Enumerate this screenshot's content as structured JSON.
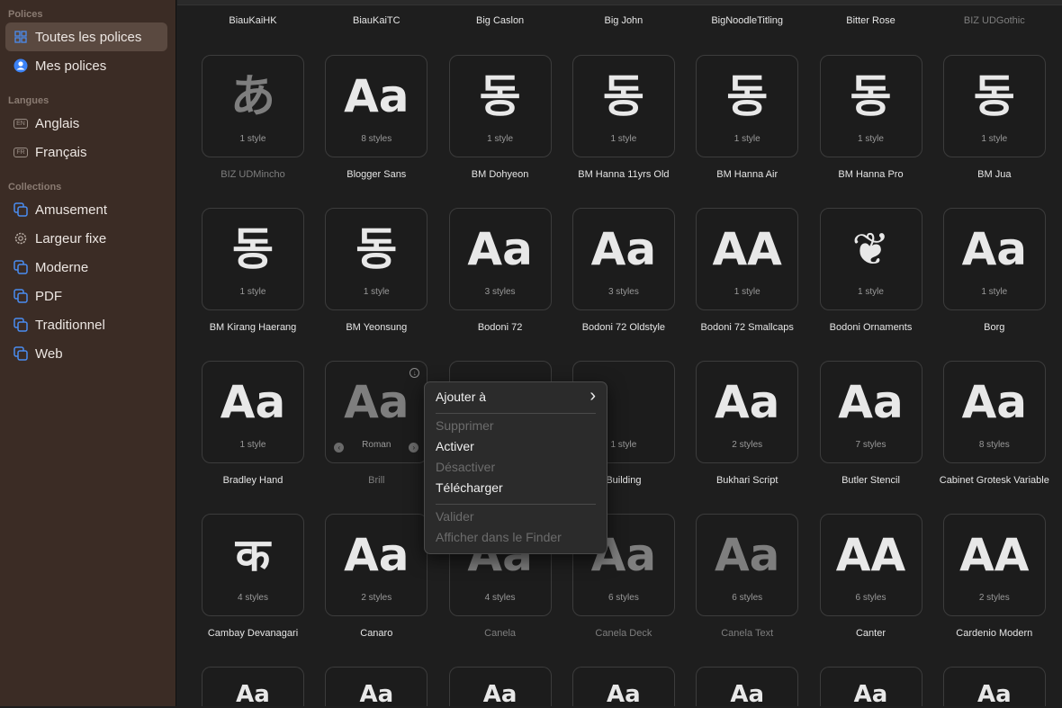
{
  "sidebar": {
    "sections": {
      "fonts": "Polices",
      "languages": "Langues",
      "collections": "Collections"
    },
    "fonts": [
      {
        "label": "Toutes les polices",
        "icon": "grid-icon",
        "selected": true
      },
      {
        "label": "Mes polices",
        "icon": "person-circle-icon"
      }
    ],
    "languages": [
      {
        "label": "Anglais",
        "badge": "EN"
      },
      {
        "label": "Français",
        "badge": "FR"
      }
    ],
    "collections": [
      {
        "label": "Amusement",
        "icon": "collection-icon"
      },
      {
        "label": "Largeur fixe",
        "icon": "gear-icon"
      },
      {
        "label": "Moderne",
        "icon": "collection-icon"
      },
      {
        "label": "PDF",
        "icon": "collection-icon"
      },
      {
        "label": "Traditionnel",
        "icon": "collection-icon"
      },
      {
        "label": "Web",
        "icon": "collection-icon"
      }
    ]
  },
  "colors": {
    "accent": "#3b82f6",
    "sidebar": "#3b2c25",
    "main": "#1e1e1e"
  },
  "top_names": [
    {
      "name": "BiauKaiHK"
    },
    {
      "name": "BiauKaiTC"
    },
    {
      "name": "Big Caslon"
    },
    {
      "name": "Big John"
    },
    {
      "name": "BigNoodleTitling"
    },
    {
      "name": "Bitter Rose"
    },
    {
      "name": "BIZ UDGothic",
      "dim": true
    }
  ],
  "fonts": [
    {
      "name": "BIZ UDMincho",
      "styles": "1 style",
      "preview": "あ",
      "dim": true
    },
    {
      "name": "Blogger Sans",
      "styles": "8 styles",
      "preview": "Aa"
    },
    {
      "name": "BM Dohyeon",
      "styles": "1 style",
      "preview": "동"
    },
    {
      "name": "BM Hanna 11yrs Old",
      "styles": "1 style",
      "preview": "동"
    },
    {
      "name": "BM Hanna Air",
      "styles": "1 style",
      "preview": "동"
    },
    {
      "name": "BM Hanna Pro",
      "styles": "1 style",
      "preview": "동"
    },
    {
      "name": "BM Jua",
      "styles": "1 style",
      "preview": "동"
    },
    {
      "name": "BM Kirang Haerang",
      "styles": "1 style",
      "preview": "동"
    },
    {
      "name": "BM Yeonsung",
      "styles": "1 style",
      "preview": "동"
    },
    {
      "name": "Bodoni 72",
      "styles": "3 styles",
      "preview": "Aa"
    },
    {
      "name": "Bodoni 72 Oldstyle",
      "styles": "3 styles",
      "preview": "Aa"
    },
    {
      "name": "Bodoni 72 Smallcaps",
      "styles": "1 style",
      "preview": "AA"
    },
    {
      "name": "Bodoni Ornaments",
      "styles": "1 style",
      "preview": "❦"
    },
    {
      "name": "Borg",
      "styles": "1 style",
      "preview": "Aa"
    },
    {
      "name": "Bradley Hand",
      "styles": "1 style",
      "preview": "Aa"
    },
    {
      "name": "Brill",
      "styles": "Roman",
      "preview": "Aa",
      "dim": true,
      "hover": true
    },
    {
      "name": "",
      "styles": "",
      "preview": ""
    },
    {
      "name": "Building",
      "styles": "1 style",
      "preview": ""
    },
    {
      "name": "Bukhari Script",
      "styles": "2 styles",
      "preview": "Aa"
    },
    {
      "name": "Butler Stencil",
      "styles": "7 styles",
      "preview": "Aa"
    },
    {
      "name": "Cabinet Grotesk Variable",
      "styles": "8 styles",
      "preview": "Aa"
    },
    {
      "name": "Cambay Devanagari",
      "styles": "4 styles",
      "preview": "क"
    },
    {
      "name": "Canaro",
      "styles": "2 styles",
      "preview": "Aa"
    },
    {
      "name": "Canela",
      "styles": "4 styles",
      "preview": "Aa",
      "dim": true
    },
    {
      "name": "Canela Deck",
      "styles": "6 styles",
      "preview": "Aa",
      "dim": true
    },
    {
      "name": "Canela Text",
      "styles": "6 styles",
      "preview": "Aa",
      "dim": true
    },
    {
      "name": "Canter",
      "styles": "6 styles",
      "preview": "AA"
    },
    {
      "name": "Cardenio Modern",
      "styles": "2 styles",
      "preview": "AA"
    },
    {
      "name": "",
      "styles": "",
      "preview": "Aa"
    },
    {
      "name": "",
      "styles": "",
      "preview": "Aa"
    },
    {
      "name": "",
      "styles": "",
      "preview": "Aa"
    },
    {
      "name": "",
      "styles": "",
      "preview": "Aa"
    },
    {
      "name": "",
      "styles": "",
      "preview": "Aa"
    },
    {
      "name": "",
      "styles": "",
      "preview": "Aa"
    },
    {
      "name": "",
      "styles": "",
      "preview": "Aa"
    }
  ],
  "context_menu": {
    "items": [
      {
        "label": "Ajouter à",
        "submenu": true
      },
      {
        "sep": true
      },
      {
        "label": "Supprimer",
        "disabled": true
      },
      {
        "label": "Activer"
      },
      {
        "label": "Désactiver",
        "disabled": true
      },
      {
        "label": "Télécharger"
      },
      {
        "sep": true
      },
      {
        "label": "Valider",
        "disabled": true
      },
      {
        "label": "Afficher dans le Finder",
        "disabled": true
      }
    ]
  }
}
